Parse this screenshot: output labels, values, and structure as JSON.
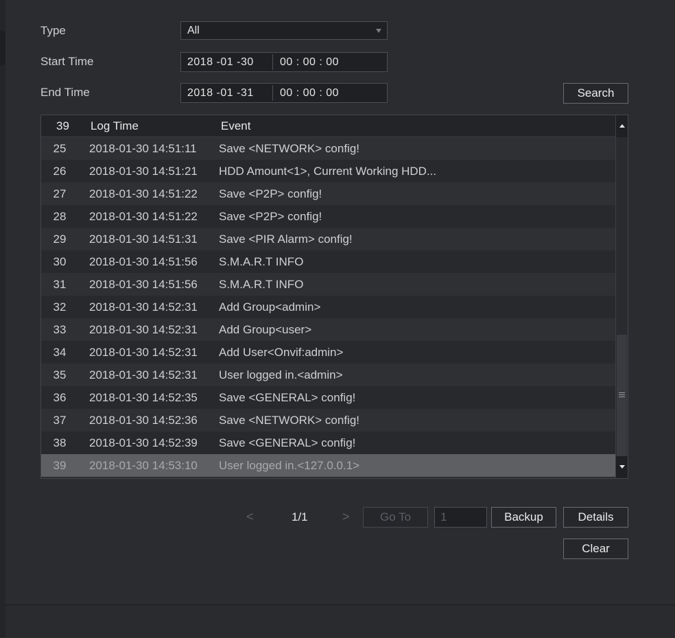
{
  "filters": {
    "type_label": "Type",
    "type_value": "All",
    "start_label": "Start Time",
    "start_date": "2018 -01 -30",
    "start_time": "00 : 00 : 00",
    "end_label": "End Time",
    "end_date": "2018 -01 -31",
    "end_time": "00 : 00 : 00",
    "search_label": "Search"
  },
  "table": {
    "count": "39",
    "col_time": "Log Time",
    "col_event": "Event",
    "rows": [
      {
        "no": "25",
        "time": "2018-01-30 14:51:11",
        "event": "Save <NETWORK> config!"
      },
      {
        "no": "26",
        "time": "2018-01-30 14:51:21",
        "event": "HDD Amount<1>, Current Working HDD..."
      },
      {
        "no": "27",
        "time": "2018-01-30 14:51:22",
        "event": "Save <P2P> config!"
      },
      {
        "no": "28",
        "time": "2018-01-30 14:51:22",
        "event": "Save <P2P> config!"
      },
      {
        "no": "29",
        "time": "2018-01-30 14:51:31",
        "event": "Save <PIR Alarm> config!"
      },
      {
        "no": "30",
        "time": "2018-01-30 14:51:56",
        "event": "S.M.A.R.T INFO"
      },
      {
        "no": "31",
        "time": "2018-01-30 14:51:56",
        "event": "S.M.A.R.T INFO"
      },
      {
        "no": "32",
        "time": "2018-01-30 14:52:31",
        "event": "Add Group<admin>"
      },
      {
        "no": "33",
        "time": "2018-01-30 14:52:31",
        "event": "Add Group<user>"
      },
      {
        "no": "34",
        "time": "2018-01-30 14:52:31",
        "event": "Add User<Onvif:admin>"
      },
      {
        "no": "35",
        "time": "2018-01-30 14:52:31",
        "event": "User logged in.<admin>"
      },
      {
        "no": "36",
        "time": "2018-01-30 14:52:35",
        "event": "Save <GENERAL> config!"
      },
      {
        "no": "37",
        "time": "2018-01-30 14:52:36",
        "event": "Save <NETWORK> config!"
      },
      {
        "no": "38",
        "time": "2018-01-30 14:52:39",
        "event": "Save <GENERAL> config!"
      },
      {
        "no": "39",
        "time": "2018-01-30 14:53:10",
        "event": "User logged in.<127.0.0.1>"
      }
    ],
    "selected_row": "39"
  },
  "pager": {
    "prev": "<",
    "page": "1/1",
    "next": ">",
    "goto_label": "Go To",
    "page_input": "1"
  },
  "actions": {
    "backup_label": "Backup",
    "details_label": "Details",
    "clear_label": "Clear"
  },
  "icons": [
    "dropdown-arrow-icon",
    "scroll-up-icon",
    "scroll-down-icon",
    "scroll-grip-icon",
    "prev-page-icon",
    "next-page-icon"
  ]
}
